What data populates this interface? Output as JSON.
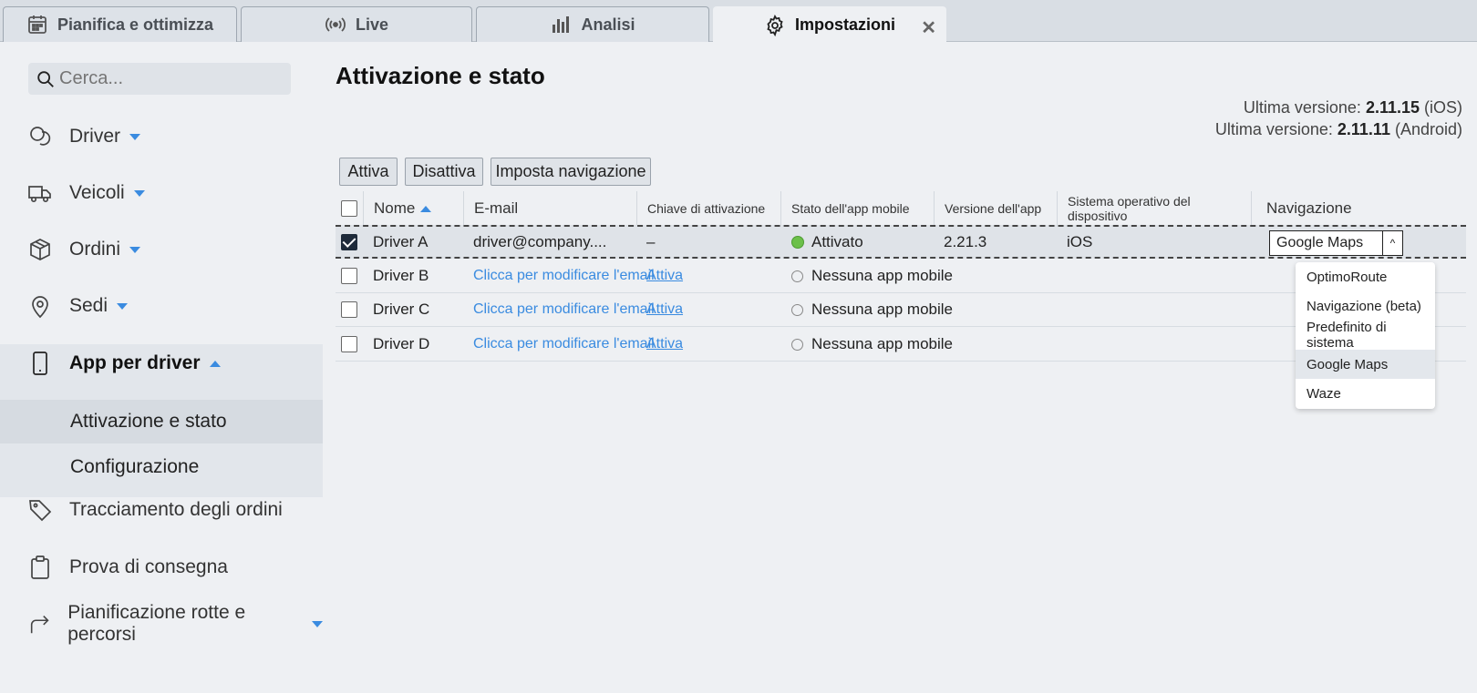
{
  "tabs": [
    {
      "label": "Pianifica e ottimizza",
      "icon": "calendar-icon"
    },
    {
      "label": "Live",
      "icon": "broadcast-icon"
    },
    {
      "label": "Analisi",
      "icon": "bar-chart-icon"
    },
    {
      "label": "Impostazioni",
      "icon": "gear-icon",
      "active": true
    }
  ],
  "search": {
    "placeholder": "Cerca..."
  },
  "sidebar": {
    "items": [
      {
        "label": "Driver",
        "icon": "chat-bubbles-icon"
      },
      {
        "label": "Veicoli",
        "icon": "truck-icon"
      },
      {
        "label": "Ordini",
        "icon": "box-icon"
      },
      {
        "label": "Sedi",
        "icon": "location-pin-icon"
      },
      {
        "label": "App per driver",
        "icon": "phone-icon"
      },
      {
        "label": "Tracciamento degli ordini",
        "icon": "tag-icon"
      },
      {
        "label": "Prova di consegna",
        "icon": "clipboard-icon"
      },
      {
        "label": "Pianificazione rotte e percorsi",
        "icon": "route-arrow-icon"
      }
    ],
    "sub_items": [
      {
        "label": "Attivazione e stato",
        "active": true
      },
      {
        "label": "Configurazione"
      }
    ]
  },
  "main": {
    "title": "Attivazione e stato",
    "version_ios": {
      "prefix": "Ultima versione: ",
      "number": "2.11.15",
      "suffix": " (iOS)"
    },
    "version_android": {
      "prefix": "Ultima versione: ",
      "number": "2.11.11",
      "suffix": " (Android)"
    },
    "buttons": {
      "activate": "Attiva",
      "deactivate": "Disattiva",
      "set_nav": "Imposta navigazione"
    }
  },
  "table": {
    "columns": [
      "Nome",
      "E-mail",
      "Chiave di attivazione",
      "Stato dell'app mobile",
      "Versione dell'app",
      "Sistema operativo del dispositivo",
      "Navigazione"
    ],
    "rows": [
      {
        "name": "Driver A",
        "email": "driver@company....",
        "key": "–",
        "status": "Attivato",
        "version": "2.21.3",
        "os": "iOS",
        "nav": "Google Maps",
        "checked": true
      },
      {
        "name": "Driver B",
        "email": "Clicca per modificare l'email",
        "key": "Attiva",
        "status": "Nessuna app mobile"
      },
      {
        "name": "Driver C",
        "email": "Clicca per modificare l'email",
        "key": "Attiva",
        "status": "Nessuna app mobile"
      },
      {
        "name": "Driver D",
        "email": "Clicca per modificare l'email",
        "key": "Attiva",
        "status": "Nessuna app mobile"
      }
    ]
  },
  "nav_dropdown": {
    "options": [
      "OptimoRoute",
      "Navigazione (beta)",
      "Predefinito di sistema",
      "Google Maps",
      "Waze"
    ],
    "highlighted": "Google Maps"
  },
  "colors": {
    "accent": "#3a8be0",
    "status_active": "#6cc04a"
  }
}
